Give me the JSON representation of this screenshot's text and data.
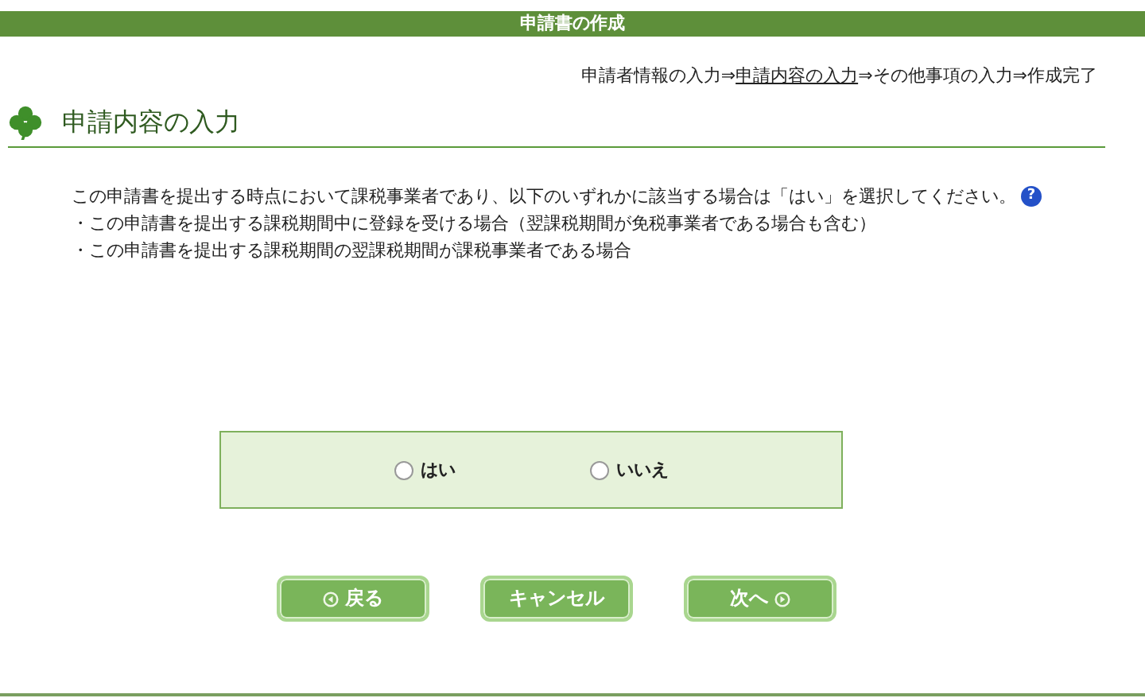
{
  "header": {
    "title": "申請書の作成"
  },
  "breadcrumb": [
    {
      "label": "申請者情報の入力",
      "selected": false
    },
    {
      "label": "⇒",
      "selected": false
    },
    {
      "label": "申請内容の入力",
      "selected": true
    },
    {
      "label": "⇒その他事項の入力⇒作成完了",
      "selected": false
    }
  ],
  "section": {
    "title": "申請内容の入力"
  },
  "instructions": {
    "lead": "この申請書を提出する時点において課税事業者であり、以下のいずれかに該当する場合は「はい」を選択してください。",
    "help": "?",
    "bullets": [
      "・この申請書を提出する課税期間中に登録を受ける場合（翌課税期間が免税事業者である場合も含む）",
      "・この申請書を提出する課税期間の翌課税期間が課税事業者である場合"
    ]
  },
  "options": [
    {
      "label": "はい",
      "selected": false
    },
    {
      "label": "いいえ",
      "selected": false
    }
  ],
  "buttons": [
    {
      "kind": "back",
      "label": "戻る"
    },
    {
      "kind": "cancel",
      "label": "キャンセル"
    },
    {
      "kind": "next",
      "label": "次へ"
    }
  ]
}
